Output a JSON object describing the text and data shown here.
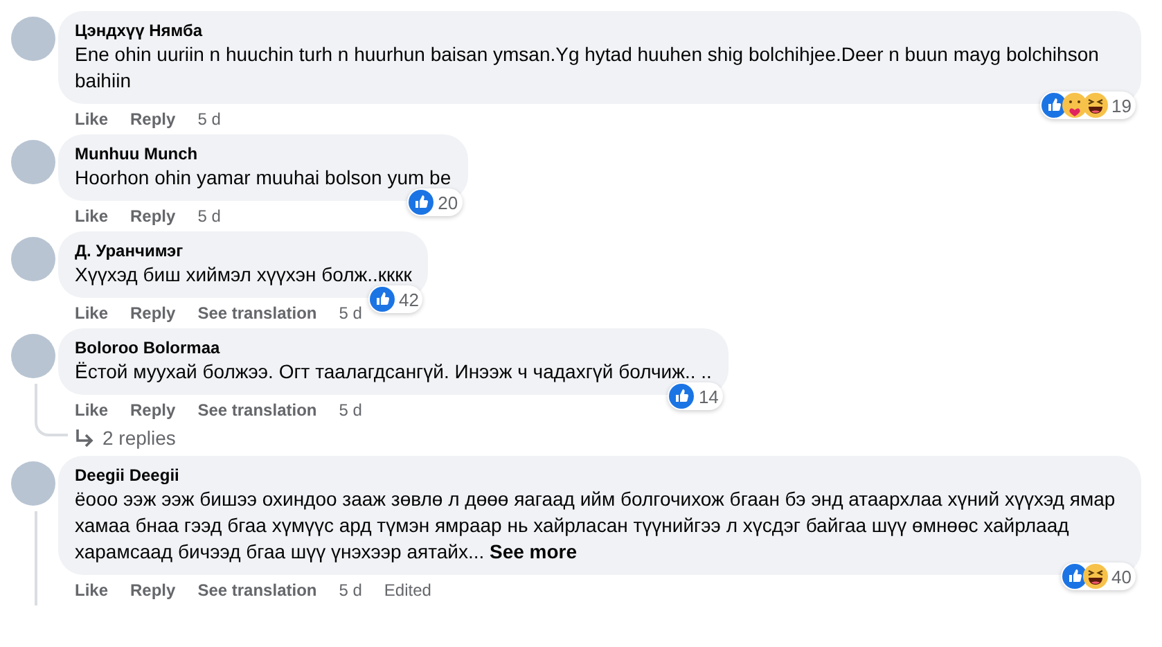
{
  "comments": [
    {
      "author": "Цэндхүү Нямба",
      "text": "Ene ohin uuriin n huuchin turh n huurhun baisan ymsan.Yg hytad huuhen shig bolchihjee.Deer n buun mayg bolchihson baihiin",
      "reactions": {
        "kinds": [
          {
            "kind": "like"
          },
          {
            "kind": "care"
          },
          {
            "kind": "haha"
          }
        ],
        "count": "19"
      },
      "actions": [
        {
          "kind": "link",
          "label": "Like"
        },
        {
          "kind": "link",
          "label": "Reply"
        },
        {
          "kind": "meta",
          "label": "5 d"
        }
      ],
      "thread_below": false
    },
    {
      "author": "Munhuu Munch",
      "text": "Hoorhon ohin yamar muuhai bolson yum be",
      "reactions": {
        "kinds": [
          {
            "kind": "like"
          }
        ],
        "count": "20"
      },
      "actions": [
        {
          "kind": "link",
          "label": "Like"
        },
        {
          "kind": "link",
          "label": "Reply"
        },
        {
          "kind": "meta",
          "label": "5 d"
        }
      ],
      "thread_below": false
    },
    {
      "author": "Д. Уранчимэг",
      "text": "Хүүхэд биш хиймэл хүүхэн болж..кккк",
      "reactions": {
        "kinds": [
          {
            "kind": "like"
          }
        ],
        "count": "42"
      },
      "actions": [
        {
          "kind": "link",
          "label": "Like"
        },
        {
          "kind": "link",
          "label": "Reply"
        },
        {
          "kind": "link",
          "label": "See translation"
        },
        {
          "kind": "meta",
          "label": "5 d"
        }
      ],
      "thread_below": false
    },
    {
      "author": "Boloroo Bolormaa",
      "text": "Ёстой муухай болжээ. Огт таалагдсангүй. Инээж ч чадахгүй болчиж.. ..",
      "reactions": {
        "kinds": [
          {
            "kind": "like"
          }
        ],
        "count": "14"
      },
      "actions": [
        {
          "kind": "link",
          "label": "Like"
        },
        {
          "kind": "link",
          "label": "Reply"
        },
        {
          "kind": "link",
          "label": "See translation"
        },
        {
          "kind": "meta",
          "label": "5 d"
        }
      ],
      "replies": "2 replies",
      "thread_below": false
    },
    {
      "author": "Deegii Deegii",
      "text": "ёооо ээж ээж бишээ охиндоо зааж зөвлө л дөөө яагаад ийм болгочихож бгаан бэ энд атаархлаа хүний хүүхэд ямар хамаа бнаа гээд бгаа хүмүүс ард түмэн ямраар нь хайрласан түүнийгээ л хүсдэг байгаа шүү өмнөөс хайрлаад харамсаад бичээд бгаа шүү үнэхээр аятайх...",
      "see_more": "See more",
      "reactions": {
        "kinds": [
          {
            "kind": "like"
          },
          {
            "kind": "haha"
          }
        ],
        "count": "40"
      },
      "actions": [
        {
          "kind": "link",
          "label": "Like"
        },
        {
          "kind": "link",
          "label": "Reply"
        },
        {
          "kind": "link",
          "label": "See translation"
        },
        {
          "kind": "meta",
          "label": "5 d"
        },
        {
          "kind": "meta",
          "label": "Edited"
        }
      ],
      "thread_below": true
    }
  ]
}
